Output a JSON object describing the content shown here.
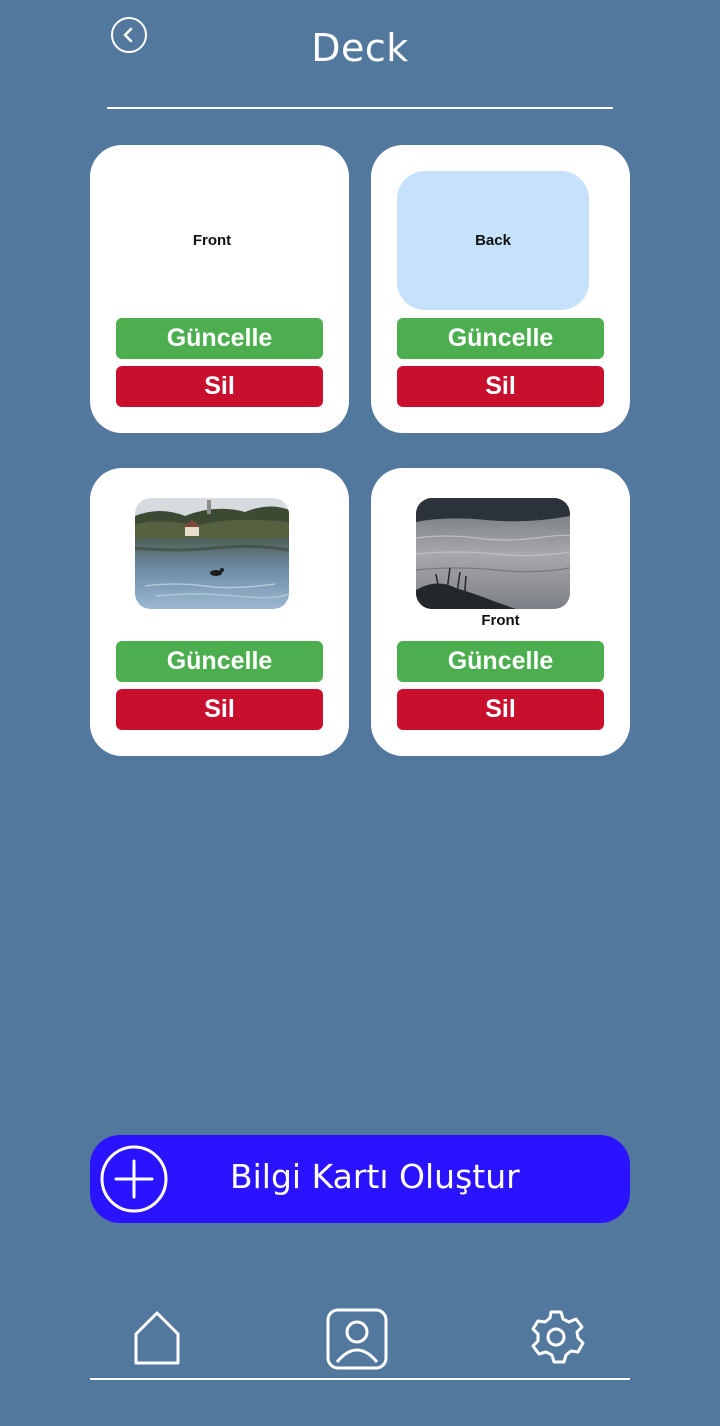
{
  "header": {
    "title": "Deck",
    "back_icon": "chevron-left-icon"
  },
  "cards": [
    {
      "face_text": "Front",
      "update_label": "Güncelle",
      "delete_label": "Sil"
    },
    {
      "face_text": "Back",
      "update_label": "Güncelle",
      "delete_label": "Sil"
    },
    {
      "update_label": "Güncelle",
      "delete_label": "Sil"
    },
    {
      "caption": "Front",
      "update_label": "Güncelle",
      "delete_label": "Sil"
    }
  ],
  "create": {
    "label": "Bilgi Kartı Oluştur",
    "icon": "plus-circle-icon"
  },
  "nav": {
    "items": [
      "home-icon",
      "profile-icon",
      "settings-icon"
    ]
  },
  "colors": {
    "background": "#52789e",
    "update": "#4cae4f",
    "delete": "#c8102e",
    "create": "#2a13ff",
    "back_face": "#c5e1fb"
  }
}
